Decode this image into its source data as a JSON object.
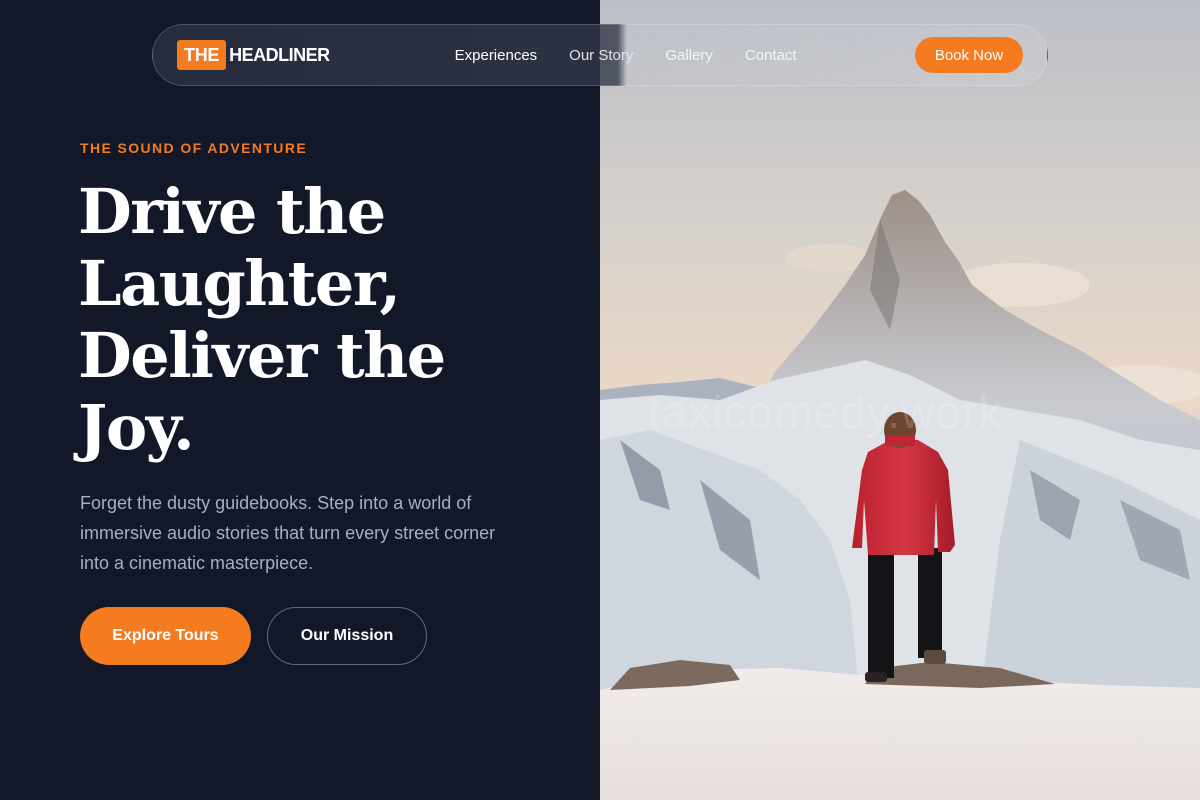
{
  "brand": {
    "badge": "THE",
    "name": "HEADLINER"
  },
  "nav": {
    "links": [
      "Experiences",
      "Our Story",
      "Gallery",
      "Contact"
    ],
    "cta": "Book Now"
  },
  "hero": {
    "eyebrow": "THE SOUND OF ADVENTURE",
    "headline": "Drive the Laughter, Deliver the Joy.",
    "description": "Forget the dusty guidebooks. Step into a world of immersive audio stories that turn every street corner into a cinematic masterpiece.",
    "primary_cta": "Explore Tours",
    "secondary_cta": "Our Mission"
  },
  "image": {
    "watermark": "taxicomedy.work"
  },
  "colors": {
    "accent": "#f47b20",
    "background": "#131829",
    "subtext": "#a8aebd"
  }
}
